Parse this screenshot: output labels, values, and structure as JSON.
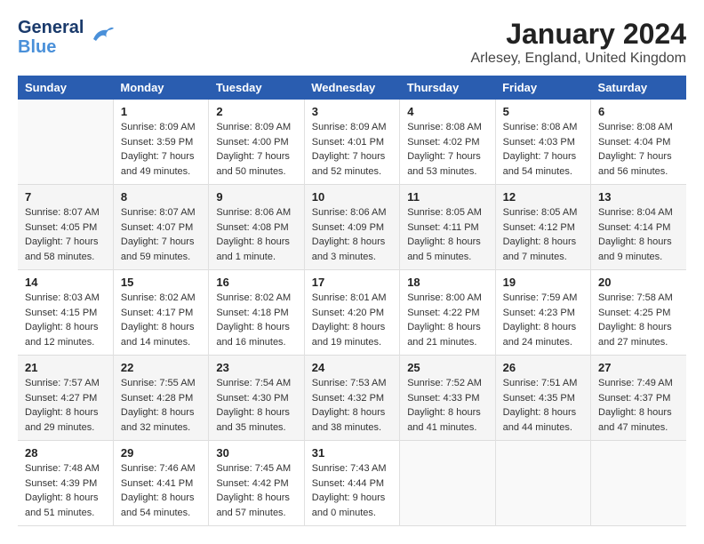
{
  "logo": {
    "general": "General",
    "blue": "Blue",
    "bird": "🐦"
  },
  "title": "January 2024",
  "subtitle": "Arlesey, England, United Kingdom",
  "headers": [
    "Sunday",
    "Monday",
    "Tuesday",
    "Wednesday",
    "Thursday",
    "Friday",
    "Saturday"
  ],
  "weeks": [
    [
      {
        "day": "",
        "info": ""
      },
      {
        "day": "1",
        "info": "Sunrise: 8:09 AM\nSunset: 3:59 PM\nDaylight: 7 hours\nand 49 minutes."
      },
      {
        "day": "2",
        "info": "Sunrise: 8:09 AM\nSunset: 4:00 PM\nDaylight: 7 hours\nand 50 minutes."
      },
      {
        "day": "3",
        "info": "Sunrise: 8:09 AM\nSunset: 4:01 PM\nDaylight: 7 hours\nand 52 minutes."
      },
      {
        "day": "4",
        "info": "Sunrise: 8:08 AM\nSunset: 4:02 PM\nDaylight: 7 hours\nand 53 minutes."
      },
      {
        "day": "5",
        "info": "Sunrise: 8:08 AM\nSunset: 4:03 PM\nDaylight: 7 hours\nand 54 minutes."
      },
      {
        "day": "6",
        "info": "Sunrise: 8:08 AM\nSunset: 4:04 PM\nDaylight: 7 hours\nand 56 minutes."
      }
    ],
    [
      {
        "day": "7",
        "info": "Sunrise: 8:07 AM\nSunset: 4:05 PM\nDaylight: 7 hours\nand 58 minutes."
      },
      {
        "day": "8",
        "info": "Sunrise: 8:07 AM\nSunset: 4:07 PM\nDaylight: 7 hours\nand 59 minutes."
      },
      {
        "day": "9",
        "info": "Sunrise: 8:06 AM\nSunset: 4:08 PM\nDaylight: 8 hours\nand 1 minute."
      },
      {
        "day": "10",
        "info": "Sunrise: 8:06 AM\nSunset: 4:09 PM\nDaylight: 8 hours\nand 3 minutes."
      },
      {
        "day": "11",
        "info": "Sunrise: 8:05 AM\nSunset: 4:11 PM\nDaylight: 8 hours\nand 5 minutes."
      },
      {
        "day": "12",
        "info": "Sunrise: 8:05 AM\nSunset: 4:12 PM\nDaylight: 8 hours\nand 7 minutes."
      },
      {
        "day": "13",
        "info": "Sunrise: 8:04 AM\nSunset: 4:14 PM\nDaylight: 8 hours\nand 9 minutes."
      }
    ],
    [
      {
        "day": "14",
        "info": "Sunrise: 8:03 AM\nSunset: 4:15 PM\nDaylight: 8 hours\nand 12 minutes."
      },
      {
        "day": "15",
        "info": "Sunrise: 8:02 AM\nSunset: 4:17 PM\nDaylight: 8 hours\nand 14 minutes."
      },
      {
        "day": "16",
        "info": "Sunrise: 8:02 AM\nSunset: 4:18 PM\nDaylight: 8 hours\nand 16 minutes."
      },
      {
        "day": "17",
        "info": "Sunrise: 8:01 AM\nSunset: 4:20 PM\nDaylight: 8 hours\nand 19 minutes."
      },
      {
        "day": "18",
        "info": "Sunrise: 8:00 AM\nSunset: 4:22 PM\nDaylight: 8 hours\nand 21 minutes."
      },
      {
        "day": "19",
        "info": "Sunrise: 7:59 AM\nSunset: 4:23 PM\nDaylight: 8 hours\nand 24 minutes."
      },
      {
        "day": "20",
        "info": "Sunrise: 7:58 AM\nSunset: 4:25 PM\nDaylight: 8 hours\nand 27 minutes."
      }
    ],
    [
      {
        "day": "21",
        "info": "Sunrise: 7:57 AM\nSunset: 4:27 PM\nDaylight: 8 hours\nand 29 minutes."
      },
      {
        "day": "22",
        "info": "Sunrise: 7:55 AM\nSunset: 4:28 PM\nDaylight: 8 hours\nand 32 minutes."
      },
      {
        "day": "23",
        "info": "Sunrise: 7:54 AM\nSunset: 4:30 PM\nDaylight: 8 hours\nand 35 minutes."
      },
      {
        "day": "24",
        "info": "Sunrise: 7:53 AM\nSunset: 4:32 PM\nDaylight: 8 hours\nand 38 minutes."
      },
      {
        "day": "25",
        "info": "Sunrise: 7:52 AM\nSunset: 4:33 PM\nDaylight: 8 hours\nand 41 minutes."
      },
      {
        "day": "26",
        "info": "Sunrise: 7:51 AM\nSunset: 4:35 PM\nDaylight: 8 hours\nand 44 minutes."
      },
      {
        "day": "27",
        "info": "Sunrise: 7:49 AM\nSunset: 4:37 PM\nDaylight: 8 hours\nand 47 minutes."
      }
    ],
    [
      {
        "day": "28",
        "info": "Sunrise: 7:48 AM\nSunset: 4:39 PM\nDaylight: 8 hours\nand 51 minutes."
      },
      {
        "day": "29",
        "info": "Sunrise: 7:46 AM\nSunset: 4:41 PM\nDaylight: 8 hours\nand 54 minutes."
      },
      {
        "day": "30",
        "info": "Sunrise: 7:45 AM\nSunset: 4:42 PM\nDaylight: 8 hours\nand 57 minutes."
      },
      {
        "day": "31",
        "info": "Sunrise: 7:43 AM\nSunset: 4:44 PM\nDaylight: 9 hours\nand 0 minutes."
      },
      {
        "day": "",
        "info": ""
      },
      {
        "day": "",
        "info": ""
      },
      {
        "day": "",
        "info": ""
      }
    ]
  ]
}
